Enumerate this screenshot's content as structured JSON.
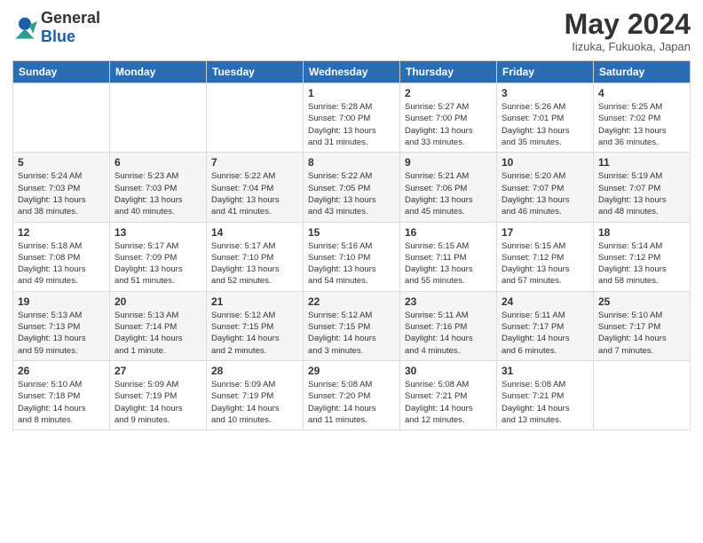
{
  "header": {
    "logo_general": "General",
    "logo_blue": "Blue",
    "title": "May 2024",
    "location": "Iizuka, Fukuoka, Japan"
  },
  "weekdays": [
    "Sunday",
    "Monday",
    "Tuesday",
    "Wednesday",
    "Thursday",
    "Friday",
    "Saturday"
  ],
  "weeks": [
    [
      {
        "day": "",
        "info": ""
      },
      {
        "day": "",
        "info": ""
      },
      {
        "day": "",
        "info": ""
      },
      {
        "day": "1",
        "info": "Sunrise: 5:28 AM\nSunset: 7:00 PM\nDaylight: 13 hours\nand 31 minutes."
      },
      {
        "day": "2",
        "info": "Sunrise: 5:27 AM\nSunset: 7:00 PM\nDaylight: 13 hours\nand 33 minutes."
      },
      {
        "day": "3",
        "info": "Sunrise: 5:26 AM\nSunset: 7:01 PM\nDaylight: 13 hours\nand 35 minutes."
      },
      {
        "day": "4",
        "info": "Sunrise: 5:25 AM\nSunset: 7:02 PM\nDaylight: 13 hours\nand 36 minutes."
      }
    ],
    [
      {
        "day": "5",
        "info": "Sunrise: 5:24 AM\nSunset: 7:03 PM\nDaylight: 13 hours\nand 38 minutes."
      },
      {
        "day": "6",
        "info": "Sunrise: 5:23 AM\nSunset: 7:03 PM\nDaylight: 13 hours\nand 40 minutes."
      },
      {
        "day": "7",
        "info": "Sunrise: 5:22 AM\nSunset: 7:04 PM\nDaylight: 13 hours\nand 41 minutes."
      },
      {
        "day": "8",
        "info": "Sunrise: 5:22 AM\nSunset: 7:05 PM\nDaylight: 13 hours\nand 43 minutes."
      },
      {
        "day": "9",
        "info": "Sunrise: 5:21 AM\nSunset: 7:06 PM\nDaylight: 13 hours\nand 45 minutes."
      },
      {
        "day": "10",
        "info": "Sunrise: 5:20 AM\nSunset: 7:07 PM\nDaylight: 13 hours\nand 46 minutes."
      },
      {
        "day": "11",
        "info": "Sunrise: 5:19 AM\nSunset: 7:07 PM\nDaylight: 13 hours\nand 48 minutes."
      }
    ],
    [
      {
        "day": "12",
        "info": "Sunrise: 5:18 AM\nSunset: 7:08 PM\nDaylight: 13 hours\nand 49 minutes."
      },
      {
        "day": "13",
        "info": "Sunrise: 5:17 AM\nSunset: 7:09 PM\nDaylight: 13 hours\nand 51 minutes."
      },
      {
        "day": "14",
        "info": "Sunrise: 5:17 AM\nSunset: 7:10 PM\nDaylight: 13 hours\nand 52 minutes."
      },
      {
        "day": "15",
        "info": "Sunrise: 5:16 AM\nSunset: 7:10 PM\nDaylight: 13 hours\nand 54 minutes."
      },
      {
        "day": "16",
        "info": "Sunrise: 5:15 AM\nSunset: 7:11 PM\nDaylight: 13 hours\nand 55 minutes."
      },
      {
        "day": "17",
        "info": "Sunrise: 5:15 AM\nSunset: 7:12 PM\nDaylight: 13 hours\nand 57 minutes."
      },
      {
        "day": "18",
        "info": "Sunrise: 5:14 AM\nSunset: 7:12 PM\nDaylight: 13 hours\nand 58 minutes."
      }
    ],
    [
      {
        "day": "19",
        "info": "Sunrise: 5:13 AM\nSunset: 7:13 PM\nDaylight: 13 hours\nand 59 minutes."
      },
      {
        "day": "20",
        "info": "Sunrise: 5:13 AM\nSunset: 7:14 PM\nDaylight: 14 hours\nand 1 minute."
      },
      {
        "day": "21",
        "info": "Sunrise: 5:12 AM\nSunset: 7:15 PM\nDaylight: 14 hours\nand 2 minutes."
      },
      {
        "day": "22",
        "info": "Sunrise: 5:12 AM\nSunset: 7:15 PM\nDaylight: 14 hours\nand 3 minutes."
      },
      {
        "day": "23",
        "info": "Sunrise: 5:11 AM\nSunset: 7:16 PM\nDaylight: 14 hours\nand 4 minutes."
      },
      {
        "day": "24",
        "info": "Sunrise: 5:11 AM\nSunset: 7:17 PM\nDaylight: 14 hours\nand 6 minutes."
      },
      {
        "day": "25",
        "info": "Sunrise: 5:10 AM\nSunset: 7:17 PM\nDaylight: 14 hours\nand 7 minutes."
      }
    ],
    [
      {
        "day": "26",
        "info": "Sunrise: 5:10 AM\nSunset: 7:18 PM\nDaylight: 14 hours\nand 8 minutes."
      },
      {
        "day": "27",
        "info": "Sunrise: 5:09 AM\nSunset: 7:19 PM\nDaylight: 14 hours\nand 9 minutes."
      },
      {
        "day": "28",
        "info": "Sunrise: 5:09 AM\nSunset: 7:19 PM\nDaylight: 14 hours\nand 10 minutes."
      },
      {
        "day": "29",
        "info": "Sunrise: 5:08 AM\nSunset: 7:20 PM\nDaylight: 14 hours\nand 11 minutes."
      },
      {
        "day": "30",
        "info": "Sunrise: 5:08 AM\nSunset: 7:21 PM\nDaylight: 14 hours\nand 12 minutes."
      },
      {
        "day": "31",
        "info": "Sunrise: 5:08 AM\nSunset: 7:21 PM\nDaylight: 14 hours\nand 13 minutes."
      },
      {
        "day": "",
        "info": ""
      }
    ]
  ]
}
